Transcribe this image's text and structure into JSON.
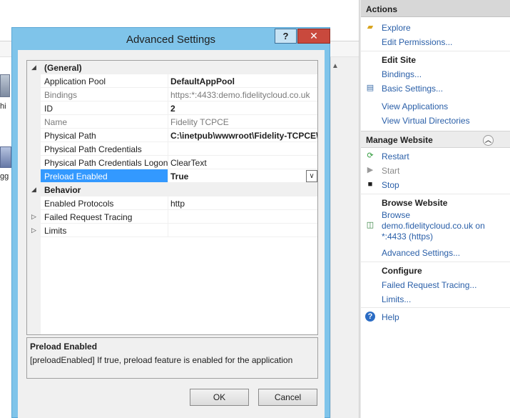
{
  "background": {
    "snippet1": "hi",
    "snippet2": "gg"
  },
  "actions": {
    "title": "Actions",
    "items": [
      {
        "label": "Explore",
        "icon": "folder-icon"
      },
      {
        "label": "Edit Permissions..."
      }
    ],
    "edit_site": {
      "title": "Edit Site",
      "bindings": "Bindings...",
      "basic_settings": "Basic Settings...",
      "view_applications": "View Applications",
      "view_virtual_directories": "View Virtual Directories"
    },
    "manage_website": {
      "title": "Manage Website",
      "restart": "Restart",
      "start": "Start",
      "stop": "Stop"
    },
    "browse_website": {
      "title": "Browse Website",
      "browse_line1": "Browse",
      "browse_line2": "demo.fidelitycloud.co.uk on",
      "browse_line3": "*:4433 (https)",
      "advanced_settings": "Advanced Settings..."
    },
    "configure": {
      "title": "Configure",
      "failed_request_tracing": "Failed Request Tracing...",
      "limits": "Limits..."
    },
    "help": "Help"
  },
  "dialog": {
    "title": "Advanced Settings",
    "help_button": "?",
    "close_button": "✕",
    "grid": {
      "general": "(General)",
      "app_pool_label": "Application Pool",
      "app_pool_value": "DefaultAppPool",
      "bindings_label": "Bindings",
      "bindings_value": "https:*:4433:demo.fidelitycloud.co.uk",
      "id_label": "ID",
      "id_value": "2",
      "name_label": "Name",
      "name_value": "Fidelity TCPCE",
      "physical_path_label": "Physical Path",
      "physical_path_value": "C:\\inetpub\\wwwroot\\Fidelity-TCPCE\\I",
      "ppc_label": "Physical Path Credentials",
      "ppc_value": "",
      "ppcl_label": "Physical Path Credentials Logon",
      "ppcl_value": "ClearText",
      "preload_label": "Preload Enabled",
      "preload_value": "True",
      "behavior": "Behavior",
      "protocols_label": "Enabled Protocols",
      "protocols_value": "http",
      "frt_label": "Failed Request Tracing",
      "limits_label": "Limits"
    },
    "description": {
      "title": "Preload Enabled",
      "text": "[preloadEnabled] If true, preload feature is enabled for the application"
    },
    "ok": "OK",
    "cancel": "Cancel"
  }
}
